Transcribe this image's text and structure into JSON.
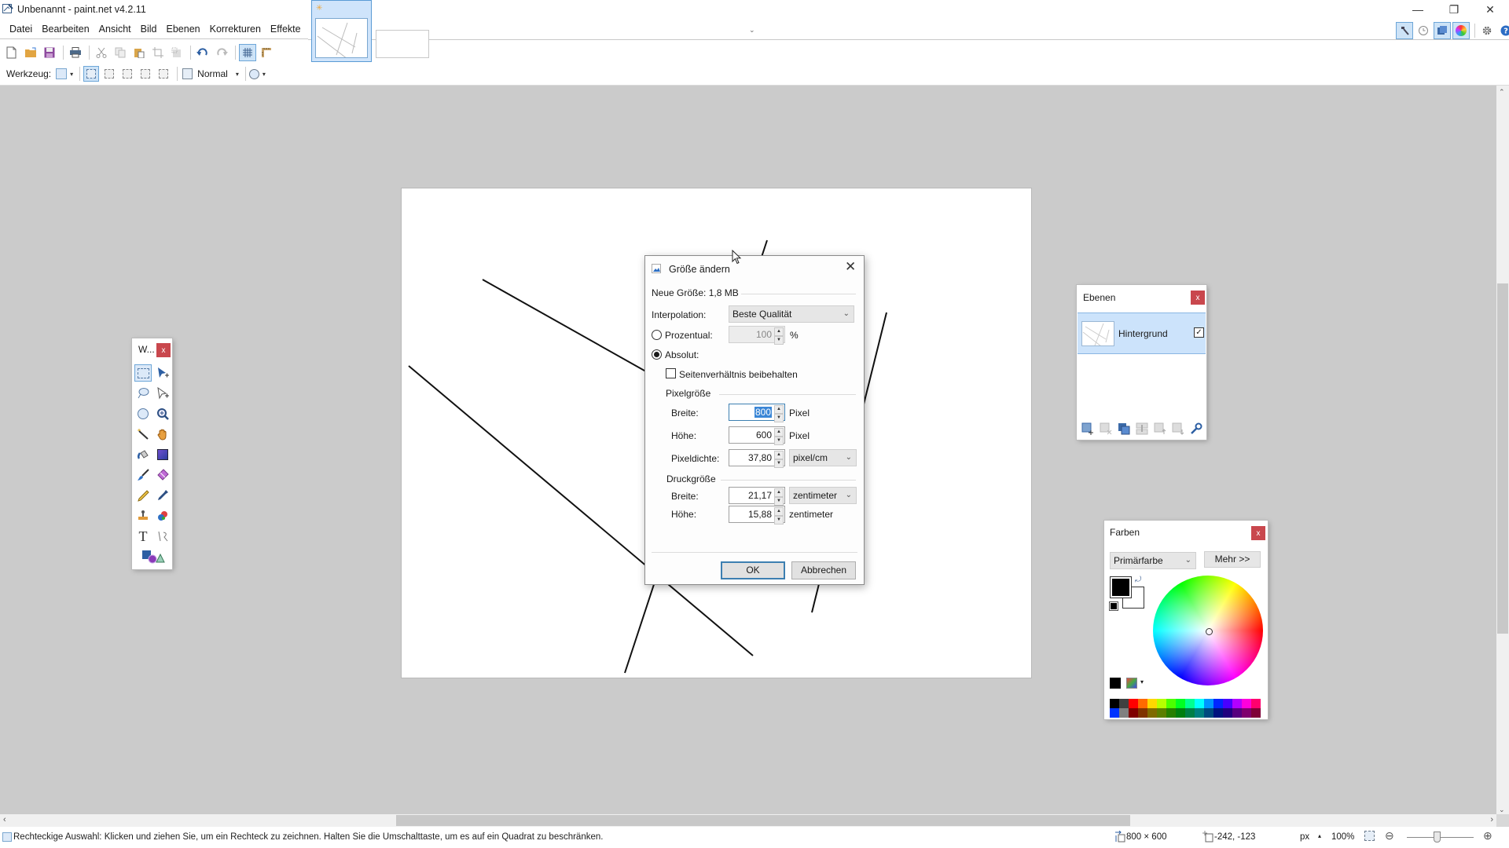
{
  "window": {
    "title": "Unbenannt - paint.net v4.2.11",
    "controls": {
      "minimize": "—",
      "maximize": "❐",
      "close": "✕"
    }
  },
  "menu": {
    "items": [
      "Datei",
      "Bearbeiten",
      "Ansicht",
      "Bild",
      "Ebenen",
      "Korrekturen",
      "Effekte"
    ]
  },
  "image_tabs": {
    "active_tab_modified_marker": "✳",
    "dropdown_glyph": "⌄"
  },
  "toolbar": {
    "icons": [
      "new-file-icon",
      "open-folder-icon",
      "save-icon",
      "print-icon",
      "cut-icon",
      "copy-icon",
      "paste-icon",
      "crop-icon",
      "deselect-icon",
      "undo-icon",
      "redo-icon",
      "grid-icon",
      "ruler-icon"
    ],
    "tool_label": "Werkzeug:",
    "blend_mode": "Normal",
    "dropdown_glyph": "▾"
  },
  "right_toolbar": {
    "icons": [
      "tools-window-icon",
      "history-icon",
      "layers-window-icon",
      "colors-window-icon",
      "settings-icon",
      "help-icon"
    ]
  },
  "tools_window": {
    "title": "W...",
    "close": "x",
    "tools": [
      {
        "name": "rectangle-select",
        "active": true
      },
      {
        "name": "move-selected-pixels",
        "active": false
      },
      {
        "name": "lasso-select",
        "active": false
      },
      {
        "name": "move-selection",
        "active": false
      },
      {
        "name": "ellipse-select",
        "active": false
      },
      {
        "name": "zoom",
        "active": false
      },
      {
        "name": "magic-wand",
        "active": false
      },
      {
        "name": "pan",
        "active": false
      },
      {
        "name": "paint-bucket",
        "active": false
      },
      {
        "name": "gradient",
        "active": false
      },
      {
        "name": "paintbrush",
        "active": false
      },
      {
        "name": "eraser",
        "active": false
      },
      {
        "name": "pencil",
        "active": false
      },
      {
        "name": "color-picker",
        "active": false
      },
      {
        "name": "clone-stamp",
        "active": false
      },
      {
        "name": "recolor",
        "active": false
      },
      {
        "name": "text",
        "active": false
      },
      {
        "name": "line-curve",
        "active": false
      },
      {
        "name": "shapes",
        "active": false
      }
    ],
    "text_tool_glyph": "T"
  },
  "dialog": {
    "title": "Größe ändern",
    "close": "✕",
    "new_size": "Neue Größe: 1,8 MB",
    "interpolation_label": "Interpolation:",
    "interpolation_value": "Beste Qualität",
    "percent_label": "Prozentual:",
    "percent_value": "100",
    "percent_unit": "%",
    "percent_checked": false,
    "absolute_label": "Absolut:",
    "absolute_checked": true,
    "keep_aspect_label": "Seitenverhältnis beibehalten",
    "keep_aspect_checked": false,
    "pixel_size_heading": "Pixelgröße",
    "pixel_width_label": "Breite:",
    "pixel_width_value": "800",
    "pixel_width_unit": "Pixel",
    "pixel_height_label": "Höhe:",
    "pixel_height_value": "600",
    "pixel_height_unit": "Pixel",
    "resolution_label": "Pixeldichte:",
    "resolution_value": "37,80",
    "resolution_unit": "pixel/cm",
    "print_size_heading": "Druckgröße",
    "print_width_label": "Breite:",
    "print_width_value": "21,17",
    "print_width_unit": "zentimeter",
    "print_height_label": "Höhe:",
    "print_height_value": "15,88",
    "print_height_unit": "zentimeter",
    "ok": "OK",
    "cancel": "Abbrechen",
    "chevron": "⌄",
    "spin_up": "▲",
    "spin_down": "▼"
  },
  "layers_window": {
    "title": "Ebenen",
    "close": "x",
    "layers": [
      {
        "name": "Hintergrund",
        "visible": true,
        "selected": true
      }
    ],
    "check_glyph": "✓",
    "toolbar_icons": [
      "add-layer-icon",
      "delete-layer-icon",
      "duplicate-layer-icon",
      "merge-layer-down-icon",
      "move-layer-up-icon",
      "move-layer-down-icon",
      "layer-properties-icon"
    ]
  },
  "colors_window": {
    "title": "Farben",
    "close": "x",
    "selector": "Primärfarbe",
    "more": "Mehr >>",
    "primary_color": "#000000",
    "secondary_color": "#ffffff",
    "swap_glyph": "⤾",
    "palette_dropdown": "▾",
    "palette_row1": [
      "#000000",
      "#404040",
      "#ff0000",
      "#ff6a00",
      "#ffd800",
      "#b6ff00",
      "#4cff00",
      "#00ff21",
      "#00ff90",
      "#00ffff",
      "#0094ff",
      "#0026ff",
      "#4800ff",
      "#b200ff",
      "#ff00dc",
      "#ff006e"
    ],
    "palette_row2": [
      "#0033ff",
      "#808080",
      "#7f0000",
      "#7f3300",
      "#7f6a00",
      "#5b7f00",
      "#267f00",
      "#007f0e",
      "#007f46",
      "#007f7f",
      "#004a7f",
      "#00137f",
      "#21007f",
      "#57007f",
      "#7f006e",
      "#7f0037"
    ]
  },
  "scrollbars": {
    "up": "⌃",
    "down": "⌄",
    "left": "‹",
    "right": "›"
  },
  "status": {
    "hint": "Rechteckige Auswahl: Klicken und ziehen Sie, um ein Rechteck zu zeichnen. Halten Sie die Umschalttaste, um es auf ein Quadrat zu beschränken.",
    "image_size": "800 × 600",
    "cursor_position": "-242, -123",
    "unit": "px",
    "unit_dropdown": "▴",
    "zoom": "100%",
    "zoom_out": "⊖",
    "zoom_in": "⊕",
    "zoom_slider_fraction": 0.45
  }
}
